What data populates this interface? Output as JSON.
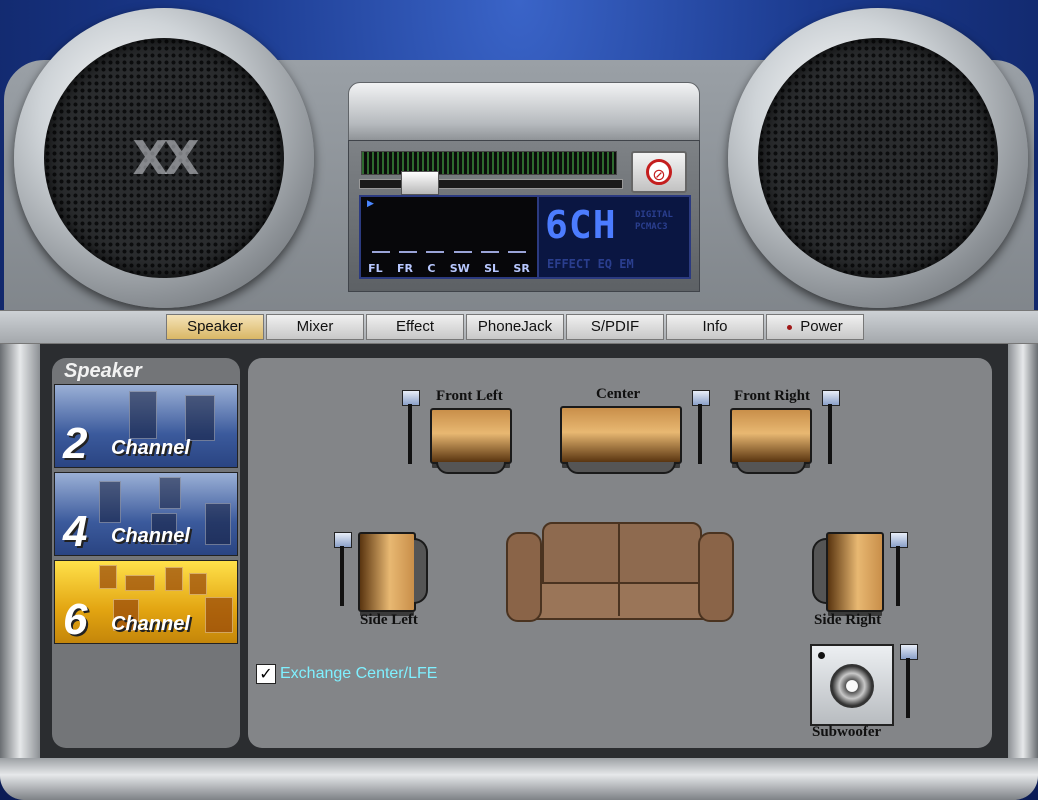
{
  "app": {
    "lcd_channel": "6CH",
    "lcd_tag_1": "DIGITAL",
    "lcd_tag_2": "PCMAC3",
    "lcd_bottom": "EFFECT EQ EM",
    "grille_logo": "XX"
  },
  "tabs": [
    {
      "label": "Speaker",
      "active": true
    },
    {
      "label": "Mixer",
      "active": false
    },
    {
      "label": "Effect",
      "active": false
    },
    {
      "label": "PhoneJack",
      "active": false
    },
    {
      "label": "S/PDIF",
      "active": false
    },
    {
      "label": "Info",
      "active": false
    },
    {
      "label": "Power",
      "active": false
    }
  ],
  "meter": {
    "channels": [
      "FL",
      "FR",
      "C",
      "SW",
      "SL",
      "SR"
    ]
  },
  "speaker_panel": {
    "title": "Speaker",
    "modes": [
      {
        "number": "2",
        "label": "Channel",
        "selected": false
      },
      {
        "number": "4",
        "label": "Channel",
        "selected": false
      },
      {
        "number": "6",
        "label": "Channel",
        "selected": true
      }
    ]
  },
  "layout_labels": {
    "front_left": "Front Left",
    "center": "Center",
    "front_right": "Front Right",
    "side_left": "Side Left",
    "side_right": "Side Right",
    "subwoofer": "Subwoofer"
  },
  "options": {
    "exchange_center_lfe": {
      "label": "Exchange Center/LFE",
      "checked": true,
      "mark": "✓"
    }
  },
  "colors": {
    "active_tab": "#d9b766",
    "selected_mode": "#e2a411",
    "lcd_text": "#4c7cff",
    "exchange_label": "#7ff0ff",
    "power_dot": "#a01818"
  },
  "icons": {
    "mute": "⊘"
  }
}
